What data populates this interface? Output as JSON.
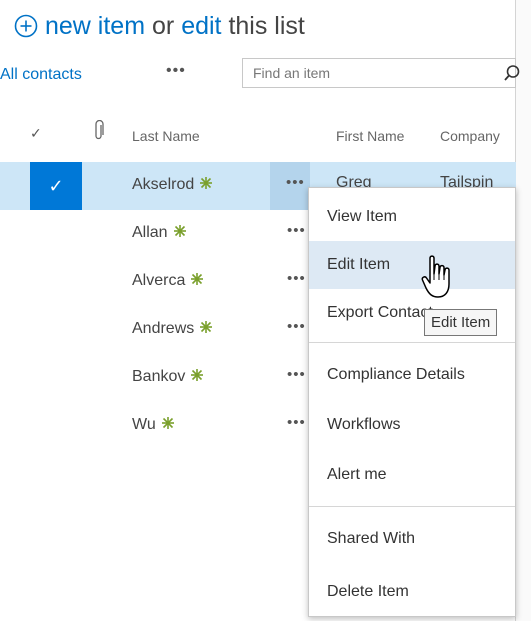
{
  "header": {
    "new_item_link": "new item",
    "or_text": "or",
    "edit_link": "edit",
    "this_list_text": "this list"
  },
  "view": {
    "name": "All contacts",
    "more": "•••",
    "search_placeholder": "Find an item"
  },
  "columns": {
    "check": "✓",
    "last_name": "Last Name",
    "first_name": "First Name",
    "company": "Company"
  },
  "rows": [
    {
      "last_name": "Akselrod",
      "ellipsis": "•••",
      "first_name": "Greg",
      "company": "Tailspin",
      "selected": true,
      "checkmark": "✓"
    },
    {
      "last_name": "Allan",
      "ellipsis": "•••",
      "first_name": "",
      "company": ""
    },
    {
      "last_name": "Alverca",
      "ellipsis": "•••",
      "first_name": "",
      "company": ""
    },
    {
      "last_name": "Andrews",
      "ellipsis": "•••",
      "first_name": "",
      "company": ""
    },
    {
      "last_name": "Bankov",
      "ellipsis": "•••",
      "first_name": "",
      "company": ""
    },
    {
      "last_name": "Wu",
      "ellipsis": "•••",
      "first_name": "",
      "company": ""
    }
  ],
  "context_menu": {
    "items": [
      "View Item",
      "Edit Item",
      "Export Contact",
      "Compliance Details",
      "Workflows",
      "Alert me",
      "Shared With",
      "Delete Item"
    ],
    "hovered": "Edit Item"
  },
  "tooltip": "Edit Item",
  "colors": {
    "link": "#0072c6",
    "selected_row": "#cde6f7",
    "selected_check": "#0078d7",
    "new_icon": "#7aa02c",
    "menu_hover": "#dde9f4"
  }
}
